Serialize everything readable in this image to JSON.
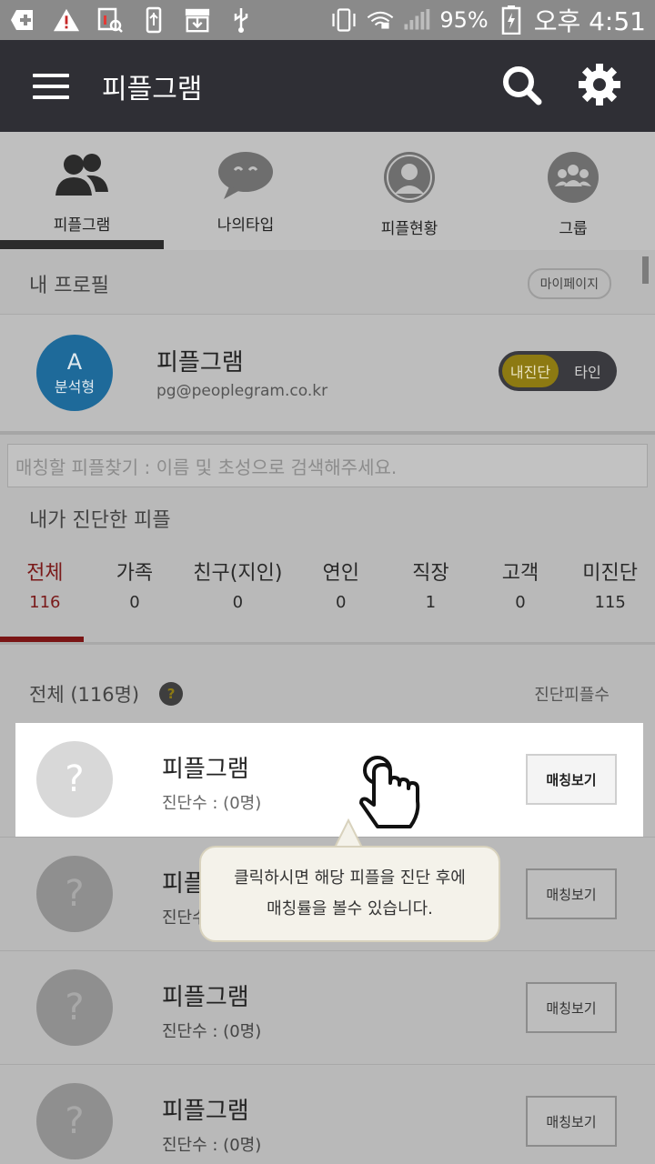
{
  "status_bar": {
    "battery_percent": "95%",
    "time": "오후 4:51",
    "icons": [
      "plus-square-icon",
      "warning-icon",
      "image-search-icon",
      "usb-icon",
      "download-icon",
      "usb-icon",
      "vibrate-icon",
      "wifi-lock-icon",
      "signal-icon",
      "battery-charging-icon"
    ]
  },
  "app_bar": {
    "title": "피플그램",
    "menu_icon": "hamburger-icon",
    "search_icon": "search-icon",
    "settings_icon": "gear-icon"
  },
  "tabs": [
    {
      "label": "피플그램",
      "icon": "people-icon",
      "active": true
    },
    {
      "label": "나의타입",
      "icon": "chat-bubble-icon",
      "active": false
    },
    {
      "label": "피플현황",
      "icon": "person-circle-icon",
      "active": false
    },
    {
      "label": "그룹",
      "icon": "group-icon",
      "active": false
    }
  ],
  "profile": {
    "section_title": "내 프로필",
    "my_page_button": "마이페이지",
    "avatar_letter": "A",
    "avatar_type": "분석형",
    "name": "피플그램",
    "email": "pg@peoplegram.co.kr",
    "toggle_on": "내진단",
    "toggle_off": "타인"
  },
  "search": {
    "placeholder": "매칭할 피플찾기 : 이름 및 초성으로 검색해주세요."
  },
  "diagnosed": {
    "section_title": "내가 진단한 피플",
    "categories": [
      {
        "name": "전체",
        "count": "116",
        "active": true
      },
      {
        "name": "가족",
        "count": "0"
      },
      {
        "name": "친구(지인)",
        "count": "0"
      },
      {
        "name": "연인",
        "count": "0"
      },
      {
        "name": "직장",
        "count": "1"
      },
      {
        "name": "고객",
        "count": "0"
      },
      {
        "name": "미진단",
        "count": "115"
      }
    ]
  },
  "list": {
    "header_title": "전체 (116명)",
    "header_right": "진단피플수",
    "help_icon": "?",
    "rows": [
      {
        "name": "피플그램",
        "sub": "진단수 : (0명)",
        "button": "매칭보기"
      },
      {
        "name": "피플그램",
        "sub": "진단수 : (0명)",
        "button": "매칭보기"
      },
      {
        "name": "피플그램",
        "sub": "진단수 : (0명)",
        "button": "매칭보기"
      },
      {
        "name": "피플그램",
        "sub": "진단수 : (0명)",
        "button": "매칭보기"
      }
    ]
  },
  "tooltip": {
    "line1": "클릭하시면 해당 피플을 진단 후에",
    "line2": "매칭률을 볼수 있습니다."
  }
}
